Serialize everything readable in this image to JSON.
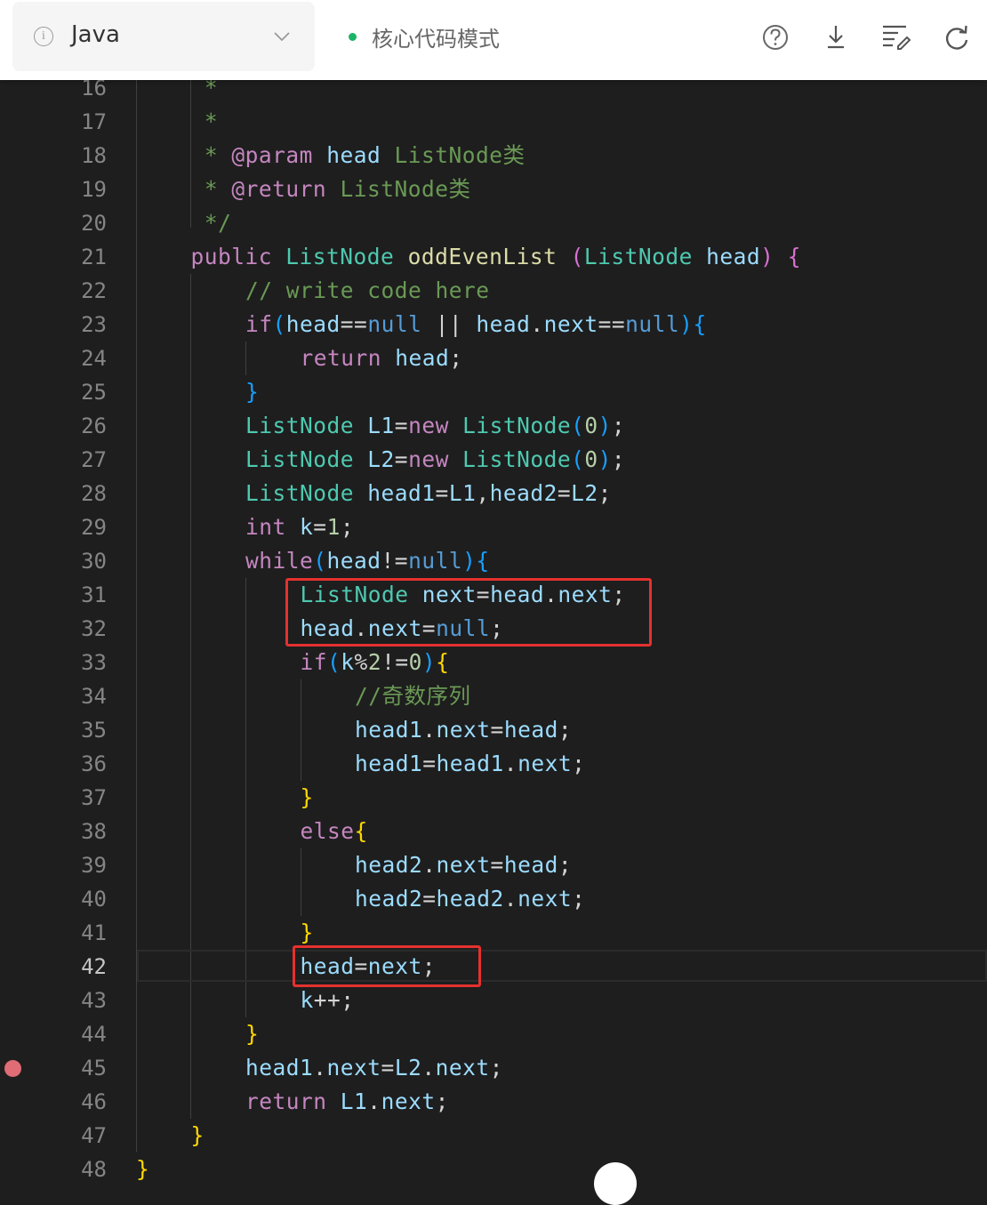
{
  "toolbar": {
    "language": "Java",
    "mode_label": "核心代码模式",
    "mode_dot_color": "#1db468",
    "icons": [
      "help-icon",
      "download-icon",
      "format-icon",
      "refresh-icon"
    ]
  },
  "editor": {
    "active_line": "42",
    "breakpoint_line": "45",
    "breakpoint_color": "#e06c75",
    "highlight_color": "#e5312f",
    "lines": [
      {
        "n": "16",
        "text": "*"
      },
      {
        "n": "17",
        "text": "*"
      },
      {
        "n": "18",
        "text": "* @param head ListNode类"
      },
      {
        "n": "19",
        "text": "* @return ListNode类"
      },
      {
        "n": "20",
        "text": "*/"
      },
      {
        "n": "21",
        "text": "public ListNode oddEvenList (ListNode head) {"
      },
      {
        "n": "22",
        "text": "// write code here"
      },
      {
        "n": "23",
        "text": "if(head==null || head.next==null){"
      },
      {
        "n": "24",
        "text": "return head;"
      },
      {
        "n": "25",
        "text": "}"
      },
      {
        "n": "26",
        "text": "ListNode L1=new ListNode(0);"
      },
      {
        "n": "27",
        "text": "ListNode L2=new ListNode(0);"
      },
      {
        "n": "28",
        "text": "ListNode head1=L1,head2=L2;"
      },
      {
        "n": "29",
        "text": "int k=1;"
      },
      {
        "n": "30",
        "text": "while(head!=null){"
      },
      {
        "n": "31",
        "text": "ListNode next=head.next;"
      },
      {
        "n": "32",
        "text": "head.next=null;"
      },
      {
        "n": "33",
        "text": "if(k%2!=0){"
      },
      {
        "n": "34",
        "text": "//奇数序列"
      },
      {
        "n": "35",
        "text": "head1.next=head;"
      },
      {
        "n": "36",
        "text": "head1=head1.next;"
      },
      {
        "n": "37",
        "text": "}"
      },
      {
        "n": "38",
        "text": "else{"
      },
      {
        "n": "39",
        "text": "head2.next=head;"
      },
      {
        "n": "40",
        "text": "head2=head2.next;"
      },
      {
        "n": "41",
        "text": "}"
      },
      {
        "n": "42",
        "text": "head=next;"
      },
      {
        "n": "43",
        "text": "k++;"
      },
      {
        "n": "44",
        "text": "}"
      },
      {
        "n": "45",
        "text": "head1.next=L2.next;"
      },
      {
        "n": "46",
        "text": "return L1.next;"
      },
      {
        "n": "47",
        "text": "}"
      },
      {
        "n": "48",
        "text": "}"
      }
    ]
  }
}
